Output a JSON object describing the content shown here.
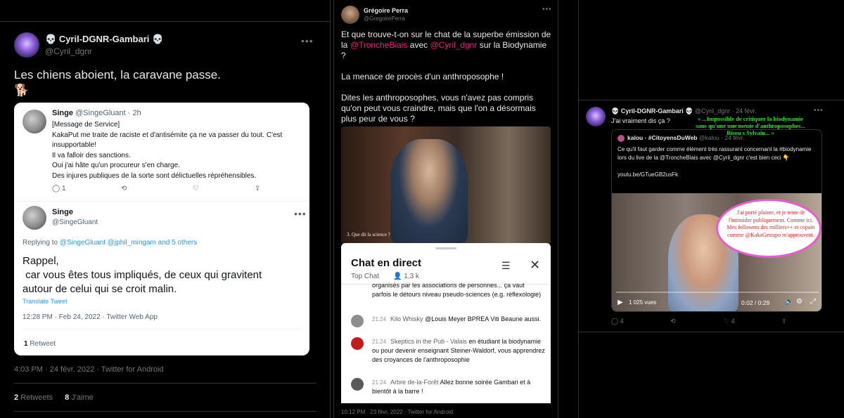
{
  "tweet1": {
    "name": "Cyril-DGNR-Gambari",
    "handle": "@Cyril_dgnr",
    "text": "Les chiens aboient, la caravane passe.",
    "emoji": "🐕",
    "quote": {
      "author": "Singe",
      "handle_time": "@SingeGluant · 2h",
      "lines": [
        "[Message de Service]",
        "KakaPut me traite de raciste et d'antisémite ça ne va passer du tout. C'est insupportable!",
        "Il va falloir des sanctions.",
        "Oui j'ai hâte qu'un procureur s'en charge.",
        "Des injures publiques de la sorte sont délictuelles répréhensibles."
      ],
      "reply_count": "1",
      "author2": "Singe",
      "handle2": "@SingeGluant",
      "replying_prefix": "Replying to",
      "replying_to": "@SingeGluant @jphil_mingam and 5 others",
      "body2_line1": "Rappel,",
      "body2_line2": " car vous êtes tous impliqués, de ceux qui gravitent",
      "body2_line3": "autour de celui qui se croit malin.",
      "translate": "Translate Tweet",
      "time": "12:28 PM · Feb 24, 2022 · Twitter Web App",
      "retweet_count": "1",
      "retweet_label": "Retweet"
    },
    "time": "4:03 PM · 24 févr. 2022 · Twitter for Android",
    "retweets_count": "2",
    "retweets_label": "Retweets",
    "likes_count": "8",
    "likes_label": "J'aime"
  },
  "tweet2": {
    "name": "Grégoire Perra",
    "handle": "@GregoirePerra",
    "p1_a": "Et que trouve-t-on sur le chat de la superbe émission de la ",
    "p1_link1": "@TroncheBiais",
    "p1_b": " avec ",
    "p1_link2": "@Cyril_dgnr",
    "p1_c": " sur la Biodynamie ?",
    "p2": "La menace de procès d'un anthroposophe !",
    "p3": "Dites les anthroposophes, vous n'avez pas compris qu'on peut vous craindre, mais que l'on a désormais plus peur de vous ?",
    "video_caption": "3. Que dit la science ?",
    "chat": {
      "title": "Chat en direct",
      "top": "Top Chat",
      "viewers": "1,3 k",
      "m0": "organisés par les associations de personnes... ça vaut parfois le détours niveau pseudo-sciences (e.g. réflexologie)",
      "m1_time": "21:24",
      "m1_author": "Kilo Whisky",
      "m1_text": "@Louis Meyer BPREA Viti Beaune aussi.",
      "m2_time": "21:24",
      "m2_author": "Skeptics in the Pub - Valais",
      "m2_text": "en étudiant la biodynamie ou pour devenir enseignant Steiner-Waldorf, vous apprendrez des croyances de l'anthroposophie",
      "m3_time": "21:24",
      "m3_author": "Arbre de-la-Forêt",
      "m3_text": "Allez bonne soirée Gambari et à bientôt à la barre !"
    },
    "time": "10:12 PM · 23 févr. 2022 · Twitter for Android"
  },
  "tweet3": {
    "name": "Cyril-DGNR-Gambari",
    "handle_time": "@Cyril_dgnr · 24 févr.",
    "text": "J'ai vraiment dis ça ?",
    "green_line1": "« ...Impossible de critiquer la biodynamie",
    "green_line2": "sans qu'une une meute d'anthroposophes...",
    "green_line3": "Bisou s Sylvain... »",
    "quote_name": "kalou · #CitoyensDuWeb",
    "quote_handle": "@kalou · 24 févr.",
    "quote_body": "Ce qu'il faut garder comme élément très rassurant concernant la #biodynamie lors du live de la @TroncheBiais avec @Cyril_dgnr c'est bien ceci 👇",
    "quote_link": "youtu.be/GTueGB2usFk",
    "bubble": "J'ai porté plainte, et je tente de l'intimider publiquement. Comme ici. Mes followers des milliers++ et copain comme @KakaGestapo m'approuvent.",
    "views": "1 025 vues",
    "duration": "0:02 / 0:29",
    "replies": "4",
    "likes": "4"
  },
  "icons": [
    "skull-icon",
    "dog-icon",
    "reply-icon",
    "retweet-icon",
    "like-icon",
    "share-icon",
    "more-icon",
    "tune-icon",
    "close-icon",
    "play-icon",
    "people-icon",
    "gear-icon",
    "volume-icon",
    "fullscreen-icon",
    "point-down-icon"
  ],
  "colors": {
    "link": "#1d9bf0",
    "pink": "#f91880",
    "green": "#23e523",
    "bubble_border": "#e85ad0",
    "bubble_text": "#e02020"
  }
}
